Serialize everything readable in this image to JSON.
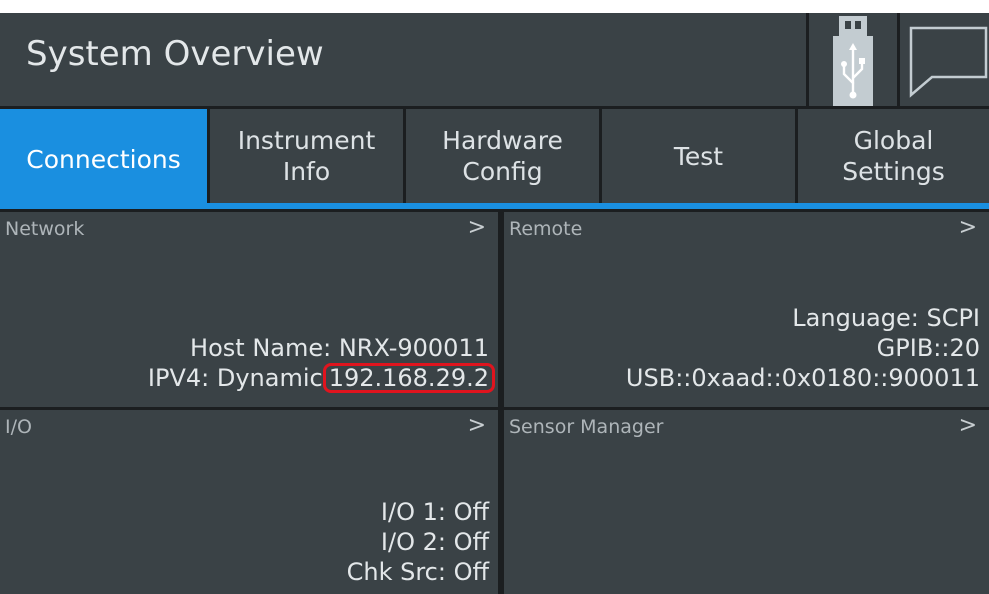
{
  "header": {
    "title": "System Overview",
    "icons": {
      "usb": "usb-icon",
      "message": "message-icon"
    }
  },
  "tabs": [
    {
      "label": "Connections",
      "active": true
    },
    {
      "label": "Instrument\nInfo",
      "active": false
    },
    {
      "label": "Hardware\nConfig",
      "active": false
    },
    {
      "label": "Test",
      "active": false
    },
    {
      "label": "Global\nSettings",
      "active": false
    }
  ],
  "panels": {
    "network": {
      "title": "Network",
      "arrow": ">",
      "host_name": "Host Name: NRX-900011",
      "ipv4_label": "IPV4: Dynamic",
      "ipv4_address": "192.168.29.2"
    },
    "remote": {
      "title": "Remote",
      "arrow": ">",
      "language": "Language: SCPI",
      "gpib": "GPIB::20",
      "usb": "USB::0xaad::0x0180::900011"
    },
    "io": {
      "title": "I/O",
      "arrow": ">",
      "io1": "I/O 1: Off",
      "io2": "I/O 2: Off",
      "chk_src": "Chk Src: Off"
    },
    "sensor_manager": {
      "title": "Sensor Manager",
      "arrow": ">"
    }
  },
  "colors": {
    "accent": "#1a8fe0",
    "panel": "#3a4246",
    "background": "#1b1e20",
    "highlight": "#e0141e"
  }
}
